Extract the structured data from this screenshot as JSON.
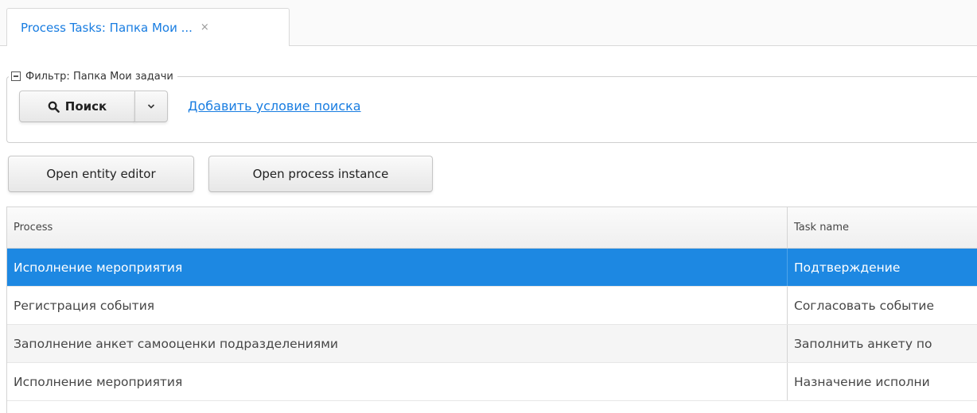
{
  "tabs": [
    {
      "title": "Process Tasks: Папка Мои ...",
      "close_glyph": "×"
    }
  ],
  "filter": {
    "legend": "Фильтр: Папка Мои задачи",
    "collapse_icon": "minus-square-icon",
    "search_button_label": "Поиск",
    "search_icon": "search-icon",
    "dropdown_icon": "chevron-down-icon",
    "add_condition_link": "Добавить условие поиска"
  },
  "toolbar": {
    "open_entity_editor": "Open entity editor",
    "open_process_instance": "Open process instance"
  },
  "table": {
    "columns": [
      "Process",
      "Task name"
    ],
    "rows": [
      {
        "process": "Исполнение мероприятия",
        "task": "Подтверждение",
        "selected": true
      },
      {
        "process": "Регистрация события",
        "task": "Согласовать событие",
        "selected": false
      },
      {
        "process": "Заполнение анкет самооценки подразделениями",
        "task": "Заполнить анкету по",
        "selected": false
      },
      {
        "process": "Исполнение мероприятия",
        "task": "Назначение исполни",
        "selected": false
      }
    ]
  },
  "colors": {
    "accent": "#197de1",
    "selected_row": "#1d88e2"
  }
}
